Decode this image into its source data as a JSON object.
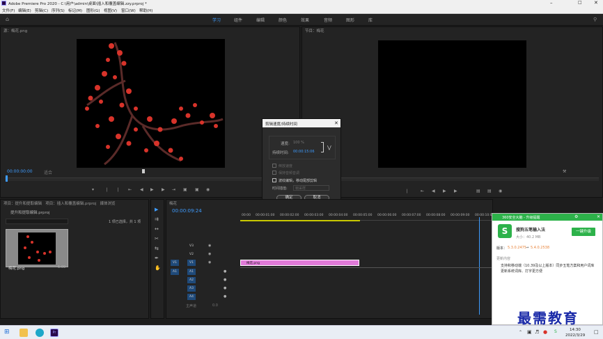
{
  "window": {
    "title": "Adobe Premiere Pro 2020 - C:\\用户\\admin\\桌面\\插入和覆盖编辑.zzy.prproj *"
  },
  "menu": [
    "文件(F)",
    "编辑(E)",
    "剪辑(C)",
    "序列(S)",
    "标记(M)",
    "图形(G)",
    "视图(V)",
    "窗口(W)",
    "帮助(H)"
  ],
  "workspaces": [
    "学习",
    "组件",
    "编辑",
    "颜色",
    "效果",
    "音频",
    "图形",
    "库"
  ],
  "source": {
    "tab": "源：梅花.png",
    "timecode": "00:00:00:00",
    "fit": "适合"
  },
  "program": {
    "tab": "节目：梅花"
  },
  "project": {
    "tab": "项目：提升和提取编辑",
    "tab2": "项目：插入和覆盖编辑.prproj",
    "tab3": "媒体浏览",
    "bin": "提升和提取编辑.prproj",
    "selection": "1 项已选择，共 1 项",
    "item_name": "梅花.png",
    "item_dur": "5:00"
  },
  "timeline": {
    "tab": "梅花",
    "timecode": "00:00:09:24",
    "ruler": [
      "00:00",
      "00:00:01:00",
      "00:00:02:00",
      "00:00:03:00",
      "00:00:04:00",
      "00:00:05:00",
      "00:00:06:00",
      "00:00:07:00",
      "00:00:08:00",
      "00:00:09:00",
      "00:00:10:00"
    ],
    "video_tracks": [
      "V3",
      "V2",
      "V1"
    ],
    "audio_tracks": [
      "A1",
      "A2",
      "A3",
      "A4"
    ],
    "src_v": "V1",
    "src_a": "A1",
    "master": "主声道",
    "master_val": "0.0",
    "clip": "梅花.png"
  },
  "dialog": {
    "title": "剪辑速度/持续时间",
    "speed_label": "速度:",
    "speed_value": "100 %",
    "duration_label": "持续时间:",
    "duration_value": "00:00:15:06",
    "reverse": "倒放速度",
    "keep_pitch": "保持音频音调",
    "ripple": "波纹编辑，移动尾部剪辑",
    "interp_label": "时间插值:",
    "interp_value": "帧采样",
    "ok": "确定",
    "cancel": "取消"
  },
  "popup": {
    "header": "360安全大脑 - 升级提醒",
    "app": "搜狗五笔输入法",
    "size": "大小：40.2 MB",
    "update_btn": "一键升级",
    "version_label": "版本：",
    "version_from": "5.3.0.2475",
    "version_to": "5.4.0.2538",
    "content_label": "更新内容",
    "content": "支持和移动端（10.39及以上版本）同步五笔方案和用户词库\n更新系统词库、打字更方便",
    "accent": "#2db24a"
  },
  "watermark": "最需教育",
  "taskbar": {
    "time": "14:30",
    "date": "2022/3/29"
  }
}
